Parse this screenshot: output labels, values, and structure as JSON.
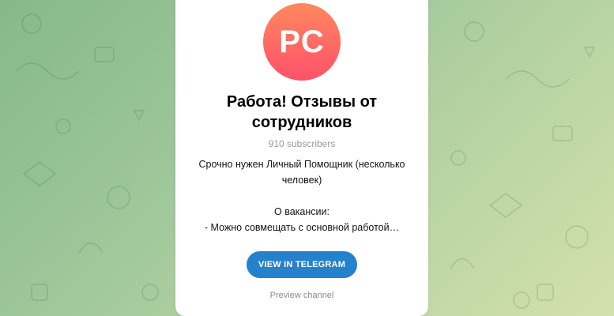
{
  "channel": {
    "avatar_initials": "PC",
    "title": "Работа! Отзывы от сотрудников",
    "subscribers": "910 subscribers",
    "description_lines": [
      "Срочно нужен Личный Помощник (несколько человек)",
      "О вакансии:",
      "- Можно совмещать с основной работой…"
    ]
  },
  "actions": {
    "view_button": "VIEW IN TELEGRAM",
    "preview_link": "Preview channel"
  },
  "colors": {
    "accent": "#2481cc",
    "avatar_gradient_top": "#ff885e",
    "avatar_gradient_bottom": "#ff516a",
    "background_green": "#86b98a"
  }
}
